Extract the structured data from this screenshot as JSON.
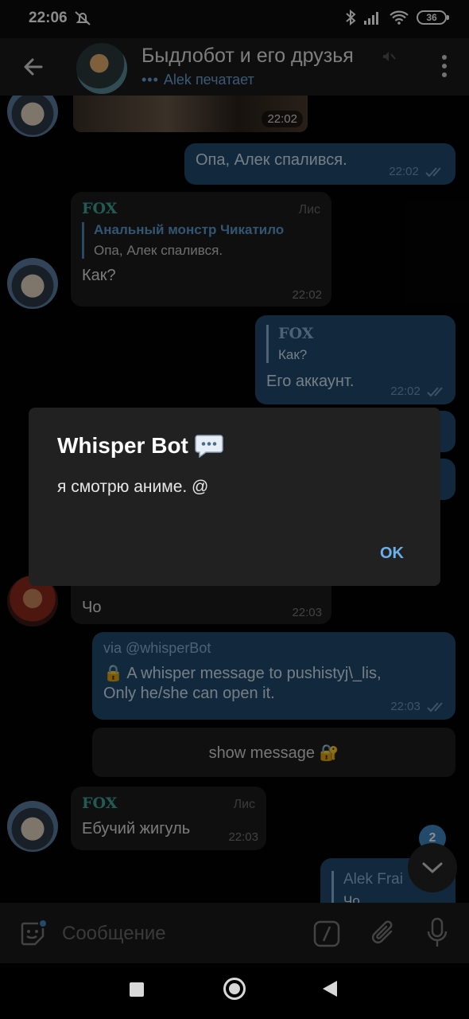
{
  "status_bar": {
    "time": "22:06",
    "battery": "36"
  },
  "header": {
    "title": "Быдлобот и его друзья",
    "typing_user": "Alek",
    "typing_text": "печатает",
    "typing_dots": "•••"
  },
  "messages": {
    "photo_time": "22:02",
    "m1": {
      "text": "Опа, Алек спалився.",
      "time": "22:02"
    },
    "m2": {
      "sender": "FOX",
      "role": "Лис",
      "reply_name": "Анальный монстр Чикатило",
      "reply_text": "Опа, Алек спалився.",
      "text": "Как?",
      "time": "22:02"
    },
    "m3": {
      "reply_name": "FOX",
      "reply_text": "Как?",
      "text": "Его аккаунт.",
      "time": "22:02"
    },
    "m4": {
      "text": "Чо",
      "time": "22:03"
    },
    "m5": {
      "via": "via @whisperBot",
      "text_line1": "🔒 A whisper message to pushistyj\\_lis,",
      "text_line2": "Only he/she can open it.",
      "time": "22:03"
    },
    "show_button": "show message 🔐",
    "m6": {
      "sender": "FOX",
      "role": "Лис",
      "text": "Ебучий жигуль",
      "time": "22:03"
    },
    "m7": {
      "reply_name": "Alek Frai",
      "reply_text": "Чо"
    }
  },
  "unread_count": "2",
  "input": {
    "placeholder": "Сообщение"
  },
  "dialog": {
    "title": "Whisper Bot",
    "text": "я смотрю аниме. @",
    "ok_label": "OK"
  },
  "colors": {
    "outgoing_bubble": "#1f4a6f",
    "incoming_bubble": "#1c1c1c",
    "accent": "#3e87c4",
    "sender_name": "#3fa79a"
  }
}
